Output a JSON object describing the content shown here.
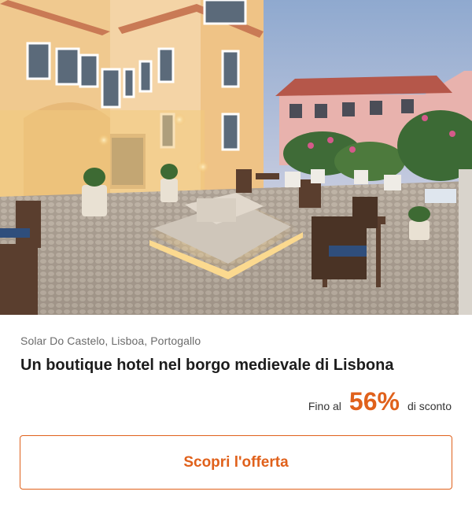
{
  "offer": {
    "location": "Solar Do Castelo, Lisboa, Portogallo",
    "title": "Un boutique hotel nel borgo medievale di Lisbona",
    "discount_prefix": "Fino al",
    "discount_value": "56%",
    "discount_suffix": "di sconto",
    "cta_label": "Scopri l'offerta"
  },
  "colors": {
    "accent": "#e0611b",
    "text_primary": "#1c1c1c",
    "text_secondary": "#6b6b6b"
  }
}
